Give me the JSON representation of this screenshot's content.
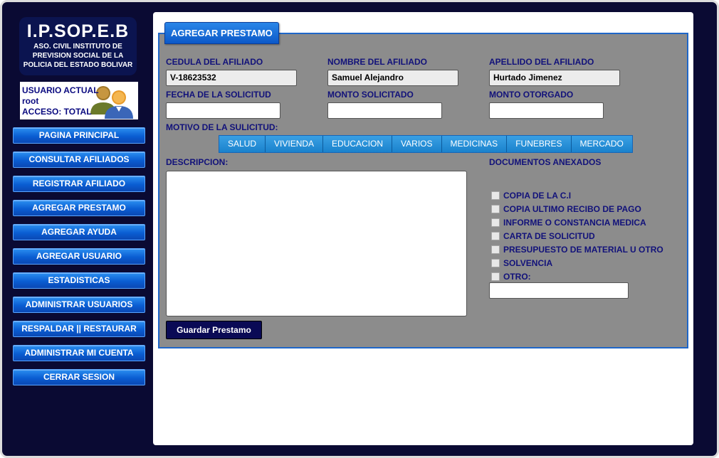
{
  "logo": {
    "title": "I.P.SOP.E.B",
    "line1": "ASO. CIVIL INSTITUTO DE",
    "line2": "PREVISION SOCIAL DE LA",
    "line3": "POLICIA DEL ESTADO BOLIVAR"
  },
  "user": {
    "label": "USUARIO ACTUAL",
    "name": "root",
    "access": "ACCESO: TOTAL",
    "icon": "users-icon"
  },
  "nav": [
    "PAGINA PRINCIPAL",
    "CONSULTAR AFILIADOS",
    "REGISTRAR AFILIADO",
    "AGREGAR PRESTAMO",
    "AGREGAR AYUDA",
    "AGREGAR USUARIO",
    "ESTADISTICAS",
    "ADMINISTRAR USUARIOS",
    "RESPALDAR || RESTAURAR",
    "ADMINISTRAR MI CUENTA",
    "CERRAR SESION"
  ],
  "form": {
    "title": "AGREGAR PRESTAMO",
    "cedula_label": "CEDULA DEL AFILIADO",
    "cedula_value": "V-18623532",
    "nombre_label": "NOMBRE DEL AFILIADO",
    "nombre_value": "Samuel Alejandro",
    "apellido_label": "APELLIDO DEL AFILIADO",
    "apellido_value": "Hurtado Jimenez",
    "fecha_label": "FECHA DE LA SOLICITUD",
    "fecha_value": "",
    "monto_sol_label": "MONTO SOLICITADO",
    "monto_sol_value": "",
    "monto_oto_label": "MONTO OTORGADO",
    "monto_oto_value": "",
    "motivo_label": "MOTIVO DE LA SULICITUD:",
    "motivos": [
      "SALUD",
      "VIVIENDA",
      "EDUCACION",
      "VARIOS",
      "MEDICINAS",
      "FUNEBRES",
      "MERCADO"
    ],
    "descripcion_label": "DESCRIPCION:",
    "documentos_label": "DOCUMENTOS ANEXADOS",
    "documentos": [
      "COPIA DE LA C.I",
      "COPIA ULTIMO RECIBO DE PAGO",
      "INFORME O CONSTANCIA MEDICA",
      "CARTA DE SOLICITUD",
      "PRESUPUESTO DE MATERIAL U OTRO",
      "SOLVENCIA",
      "OTRO:"
    ],
    "otro_value": "",
    "save_label": "Guardar Prestamo"
  },
  "colors": {
    "frame_bg": "#0a0a33",
    "nav_button": "#0a5dd2",
    "label_text": "#12127a",
    "panel_bg": "#8c8c8c",
    "panel_border": "#1e66c8",
    "save_button": "#0a0a55"
  }
}
